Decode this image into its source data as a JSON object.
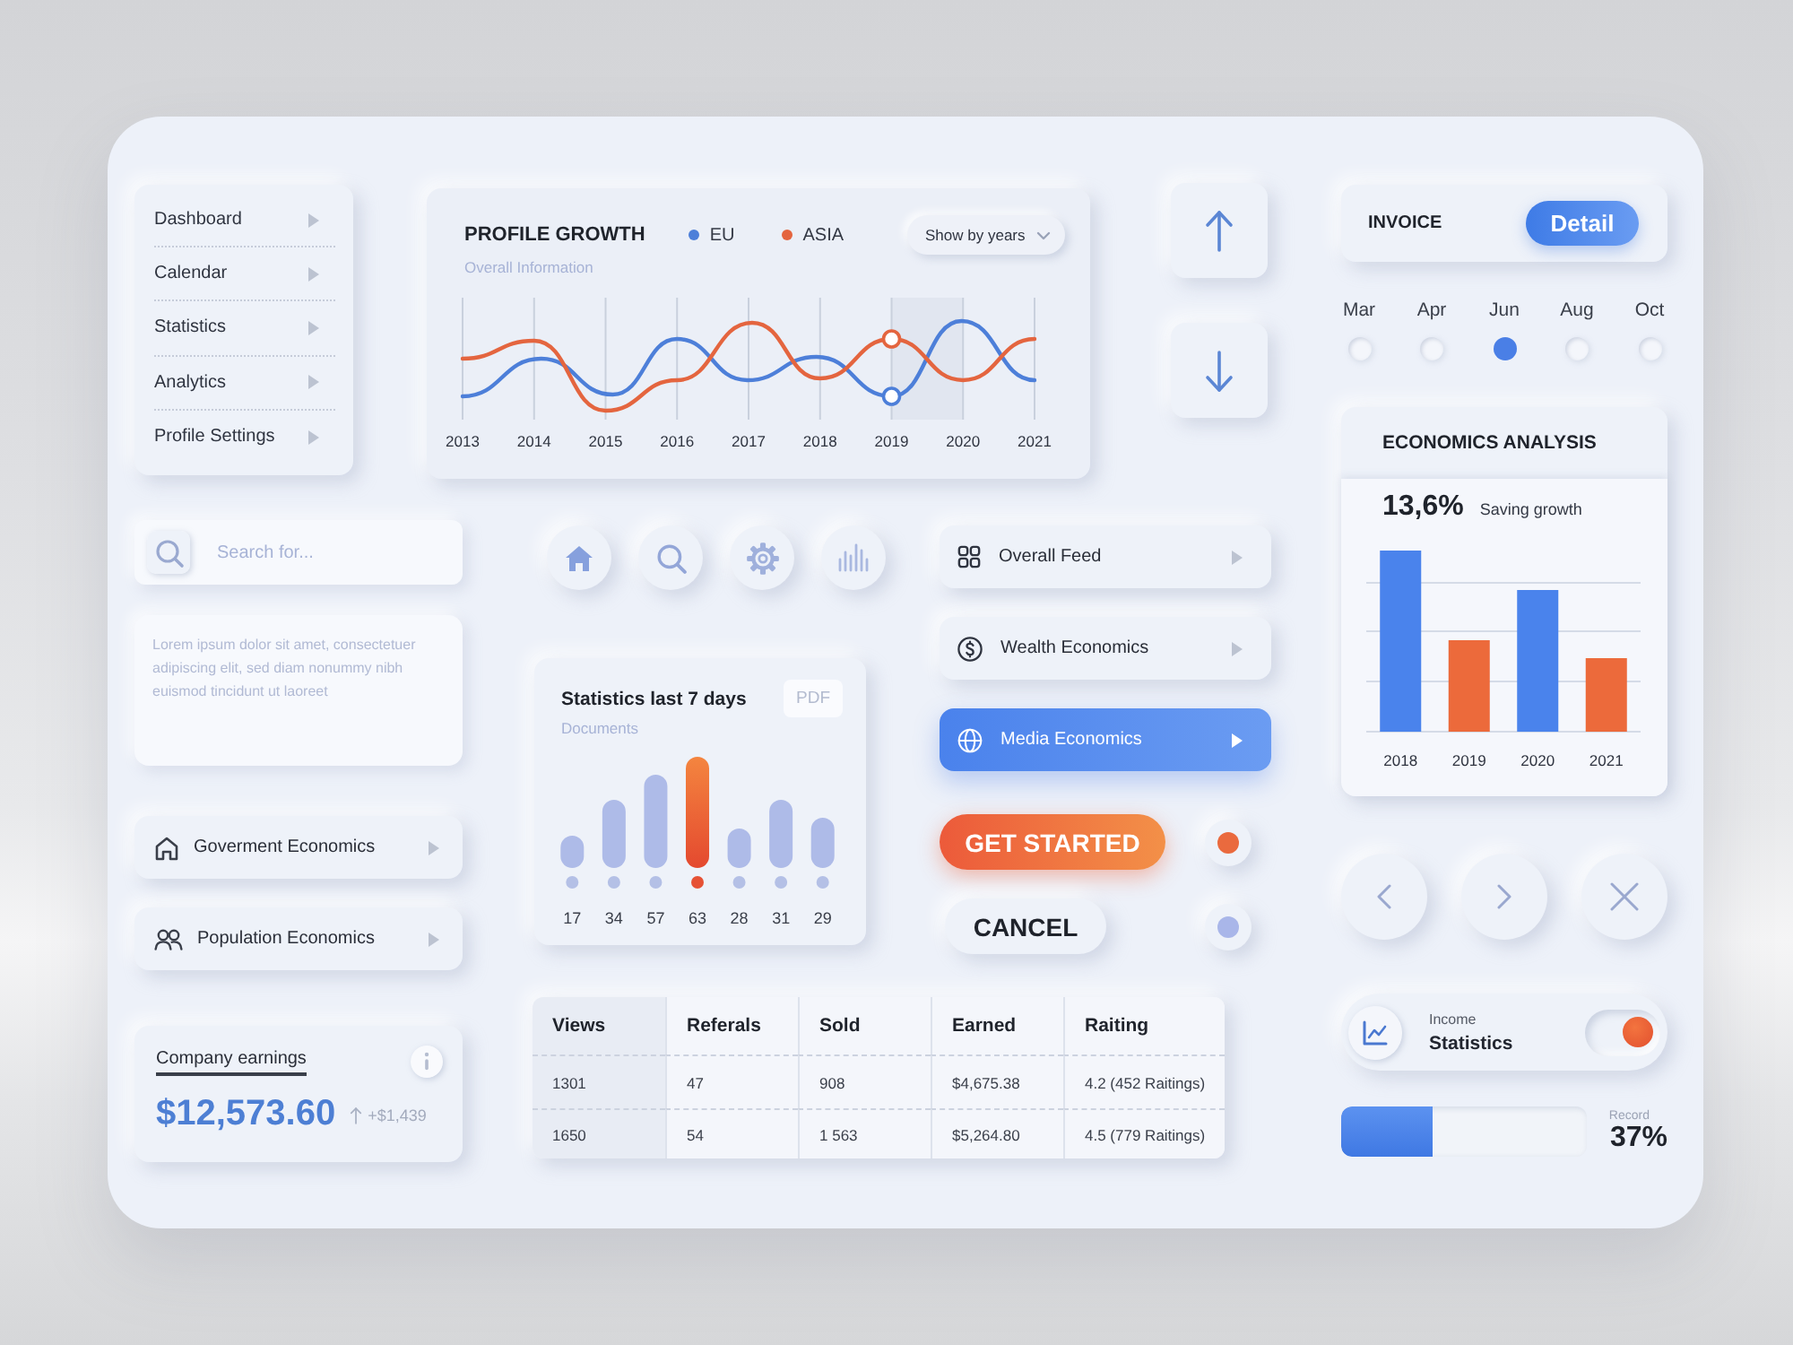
{
  "sidebar": {
    "items": [
      {
        "label": "Dashboard"
      },
      {
        "label": "Calendar"
      },
      {
        "label": "Statistics"
      },
      {
        "label": "Analytics"
      },
      {
        "label": "Profile Settings"
      }
    ]
  },
  "profile_growth": {
    "title": "PROFILE GROWTH",
    "legend": [
      {
        "label": "EU",
        "color": "#4d7fd9"
      },
      {
        "label": "ASIA",
        "color": "#e4653f"
      }
    ],
    "dropdown": "Show by years",
    "subtitle": "Overall Information",
    "years": [
      "2013",
      "2014",
      "2015",
      "2016",
      "2017",
      "2018",
      "2019",
      "2020",
      "2021"
    ]
  },
  "invoice": {
    "title": "INVOICE",
    "button": "Detail"
  },
  "months": [
    {
      "label": "Mar",
      "selected": false
    },
    {
      "label": "Apr",
      "selected": false
    },
    {
      "label": "Jun",
      "selected": true
    },
    {
      "label": "Aug",
      "selected": false
    },
    {
      "label": "Oct",
      "selected": false
    }
  ],
  "economics_analysis": {
    "title": "ECONOMICS ANALYSIS",
    "value": "13,6%",
    "caption": "Saving growth",
    "bars": [
      {
        "label": "2018",
        "color": "#4a83ec"
      },
      {
        "label": "2019",
        "color": "#ec6a3b"
      },
      {
        "label": "2020",
        "color": "#4a83ec"
      },
      {
        "label": "2021",
        "color": "#ec6a3b"
      }
    ]
  },
  "search": {
    "placeholder": "Search for..."
  },
  "note": {
    "placeholder": "Lorem ipsum dolor sit amet, consectetuer adipiscing elit, sed diam nonummy nibh euismod tincidunt ut laoreet"
  },
  "economics_links": [
    {
      "label": "Goverment Economics"
    },
    {
      "label": "Population Economics"
    }
  ],
  "stats": {
    "title": "Statistics last 7 days",
    "tag": "PDF",
    "subtitle": "Documents",
    "days": [
      {
        "label": "17",
        "selected": false
      },
      {
        "label": "34",
        "selected": false
      },
      {
        "label": "57",
        "selected": false
      },
      {
        "label": "63",
        "selected": true
      },
      {
        "label": "28",
        "selected": false
      },
      {
        "label": "31",
        "selected": false
      },
      {
        "label": "29",
        "selected": false
      }
    ]
  },
  "feed": [
    {
      "label": "Overall Feed",
      "selected": false
    },
    {
      "label": "Wealth Economics",
      "selected": false
    },
    {
      "label": "Media Economics",
      "selected": true
    }
  ],
  "actions": [
    {
      "label": "GET STARTED",
      "kind": "primary",
      "radio": {
        "color": "#ea6a3e",
        "checked": true
      }
    },
    {
      "label": "CANCEL",
      "kind": "secondary",
      "radio": {
        "color": "#a9b6e9",
        "checked": true
      }
    }
  ],
  "earnings": {
    "title": "Company earnings",
    "amount": "$12,573.60",
    "change": "+$1,439"
  },
  "table": {
    "columns": [
      "Views",
      "Referals",
      "Sold",
      "Earned",
      "Raiting"
    ],
    "rows": [
      [
        "1301",
        "47",
        "908",
        "$4,675.38",
        "4.2 (452 Raitings)"
      ],
      [
        "1650",
        "54",
        "1 563",
        "$5,264.80",
        "4.5 (779 Raitings)"
      ]
    ]
  },
  "income": {
    "label": "Income",
    "title": "Statistics",
    "on": true
  },
  "record": {
    "label": "Record",
    "level": 0.37,
    "reading": "37%"
  }
}
